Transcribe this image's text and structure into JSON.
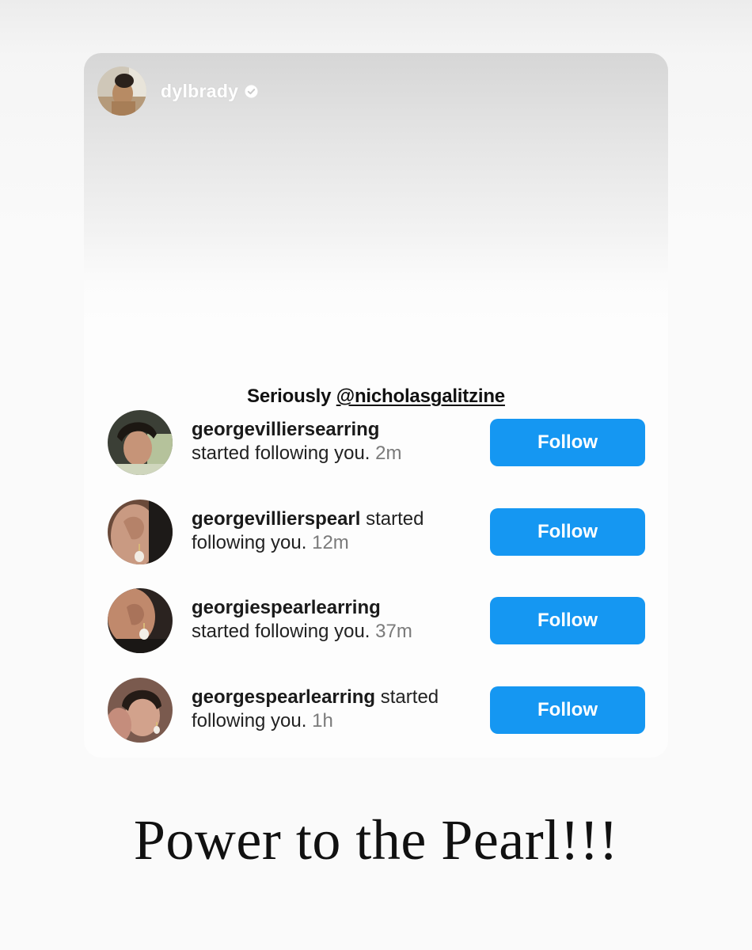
{
  "story": {
    "username": "dylbrady",
    "caption_prefix": "Seriously ",
    "caption_mention": "@nicholasgalitzine",
    "verified_icon": "verified-badge-icon",
    "accent_color": "#1597f2"
  },
  "notifications": [
    {
      "username": "georgevilliersearring",
      "action": "started following you.",
      "time": "2m",
      "button_label": "Follow"
    },
    {
      "username": "georgevillierspearl",
      "action": "started following you.",
      "time": "12m",
      "button_label": "Follow"
    },
    {
      "username": "georgiespearlearring",
      "action": "started following you.",
      "time": "37m",
      "button_label": "Follow"
    },
    {
      "username": "georgespearlearring",
      "action": "started following you.",
      "time": "1h",
      "button_label": "Follow"
    }
  ],
  "overlay_text": "Power to the Pearl!!!"
}
